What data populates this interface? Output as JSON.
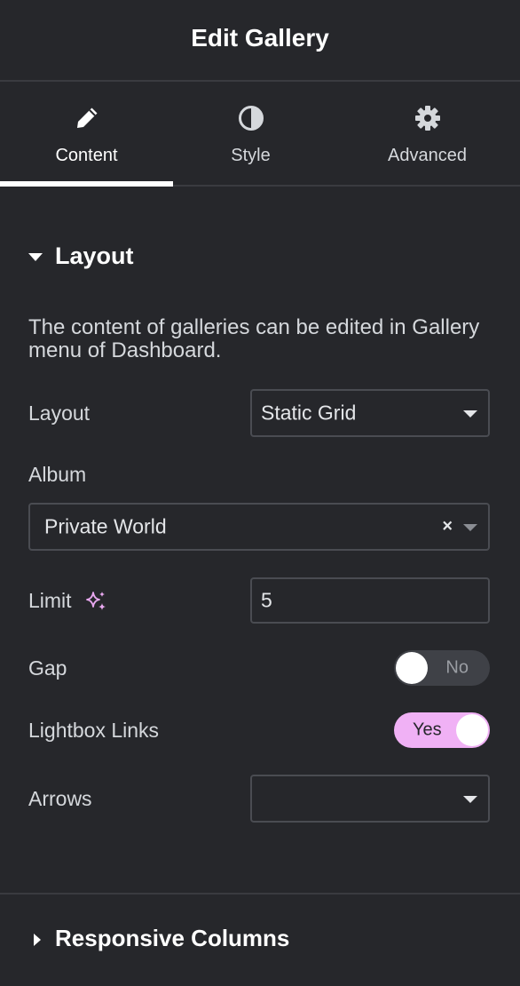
{
  "header": {
    "title": "Edit Gallery"
  },
  "tabs": [
    {
      "label": "Content",
      "icon": "pencil-icon",
      "active": true
    },
    {
      "label": "Style",
      "icon": "half-circle-contrast-icon",
      "active": false
    },
    {
      "label": "Advanced",
      "icon": "gear-icon",
      "active": false
    }
  ],
  "layout_section": {
    "title": "Layout",
    "note": "The content of galleries can be edited in Gallery menu of Dashboard.",
    "layout_label": "Layout",
    "layout_value": "Static Grid",
    "album_label": "Album",
    "album_value": "Private World",
    "album_clear": "×",
    "limit_label": "Limit",
    "limit_value": "5",
    "gap_label": "Gap",
    "gap_toggle": "No",
    "lightbox_label": "Lightbox Links",
    "lightbox_toggle": "Yes",
    "arrows_label": "Arrows",
    "arrows_value": ""
  },
  "responsive_section": {
    "title": "Responsive Columns"
  },
  "colors": {
    "background": "#26272b",
    "border": "#3a3b40",
    "accent_pink": "#f0b1f5",
    "sparkle": "#e9a8f0"
  }
}
